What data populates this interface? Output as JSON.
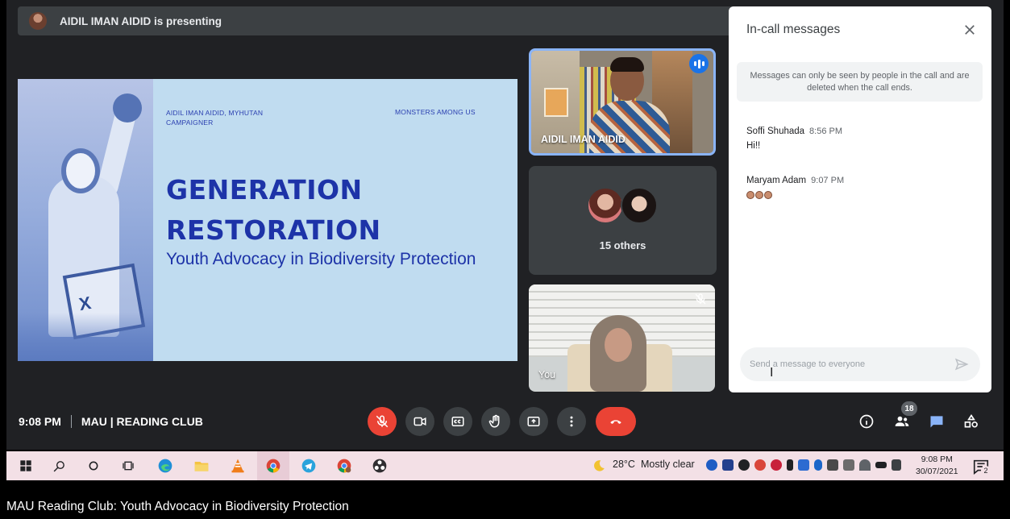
{
  "meeting": {
    "presenting_text": "AIDIL IMAN AIDID is presenting",
    "time": "9:08 PM",
    "name": "MAU | READING CLUB"
  },
  "slide": {
    "author_line": "AIDIL IMAN AIDID, MYHUTAN CAMPAIGNER",
    "header_right": "MONSTERS AMONG US",
    "title_line1": "GENERATION",
    "title_line2": "RESTORATION",
    "subtitle": "Youth Advocacy in Biodiversity Protection",
    "sign_text": "X"
  },
  "tiles": {
    "presenter_name": "AIDIL IMAN AIDID",
    "others_label": "15 others",
    "self_label": "You"
  },
  "chat": {
    "title": "In-call messages",
    "notice": "Messages can only be seen by people in the call and are deleted when the call ends.",
    "messages": [
      {
        "sender": "Soffi Shuhada",
        "time": "8:56 PM",
        "text": "Hi!!"
      },
      {
        "sender": "Maryam Adam",
        "time": "9:07 PM",
        "text": ""
      }
    ],
    "input_placeholder": "Send a message to everyone"
  },
  "controls": {
    "participants_count": "18"
  },
  "taskbar": {
    "weather_temp": "28°C",
    "weather_text": "Mostly clear",
    "clock_time": "9:08 PM",
    "clock_date": "30/07/2021",
    "notif_count": "2"
  },
  "caption": "MAU Reading Club: Youth Advocacy in Biodiversity Protection",
  "colors": {
    "meet_bg": "#202124",
    "accent_blue": "#8ab4f8",
    "end_call_red": "#ea4335",
    "slide_title": "#1d33a8",
    "slide_bg": "#c0dcf0"
  }
}
